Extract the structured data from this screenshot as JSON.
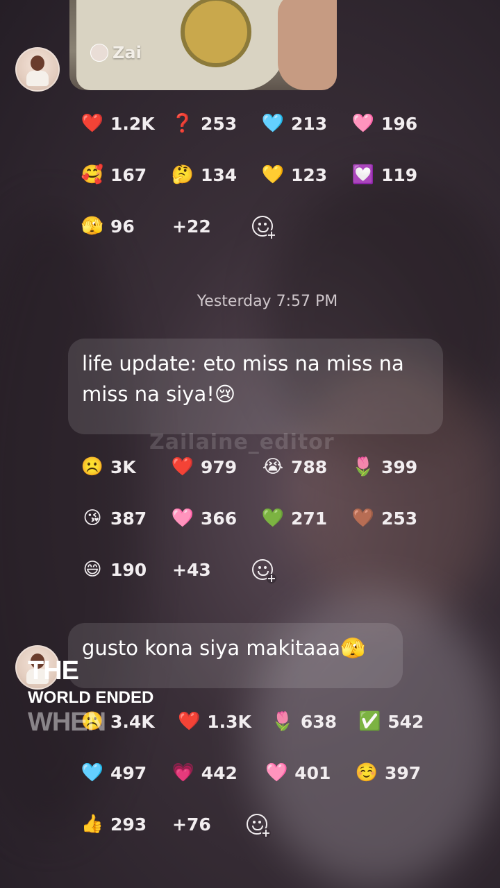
{
  "sender": {
    "name": "Zai"
  },
  "messages": [
    {
      "reactions": [
        [
          {
            "emoji": "❤️",
            "count": "1.2K"
          },
          {
            "emoji": "❓",
            "count": "253"
          },
          {
            "emoji": "🩵",
            "count": "213"
          },
          {
            "emoji": "🩷",
            "count": "196"
          }
        ],
        [
          {
            "emoji": "🥰",
            "count": "167"
          },
          {
            "emoji": "🤔",
            "count": "134"
          },
          {
            "emoji": "💛",
            "count": "123"
          },
          {
            "emoji": "💟",
            "count": "119"
          }
        ],
        [
          {
            "emoji": "🫣",
            "count": "96"
          }
        ]
      ],
      "more": "+22"
    },
    {
      "text": "life update: eto miss na miss na miss na siya!😢",
      "reactions": [
        [
          {
            "emoji": "☹️",
            "count": "3K"
          },
          {
            "emoji": "❤️",
            "count": "979"
          },
          {
            "emoji": "😭",
            "count": "788"
          },
          {
            "emoji": "🌷",
            "count": "399"
          }
        ],
        [
          {
            "emoji": "😘",
            "count": "387"
          },
          {
            "emoji": "🩷",
            "count": "366"
          },
          {
            "emoji": "💚",
            "count": "271"
          },
          {
            "emoji": "🤎",
            "count": "253"
          }
        ],
        [
          {
            "emoji": "😄",
            "count": "190"
          }
        ]
      ],
      "more": "+43"
    },
    {
      "text": "gusto kona siya makitaaa🫣",
      "reactions": [
        [
          {
            "emoji": "☹️",
            "count": "3.4K"
          },
          {
            "emoji": "❤️",
            "count": "1.3K"
          },
          {
            "emoji": "🌷",
            "count": "638"
          },
          {
            "emoji": "✅",
            "count": "542"
          }
        ],
        [
          {
            "emoji": "🩵",
            "count": "497"
          },
          {
            "emoji": "💗",
            "count": "442"
          },
          {
            "emoji": "🩷",
            "count": "401"
          },
          {
            "emoji": "☺️",
            "count": "397"
          }
        ],
        [
          {
            "emoji": "👍",
            "count": "293"
          }
        ]
      ],
      "more": "+76"
    }
  ],
  "timestamp": "Yesterday 7:57 PM",
  "watermark": "Zailaine_editor",
  "overlay": {
    "line1": "THE",
    "line2": "WORLD ENDED",
    "line3": "WHEN"
  }
}
